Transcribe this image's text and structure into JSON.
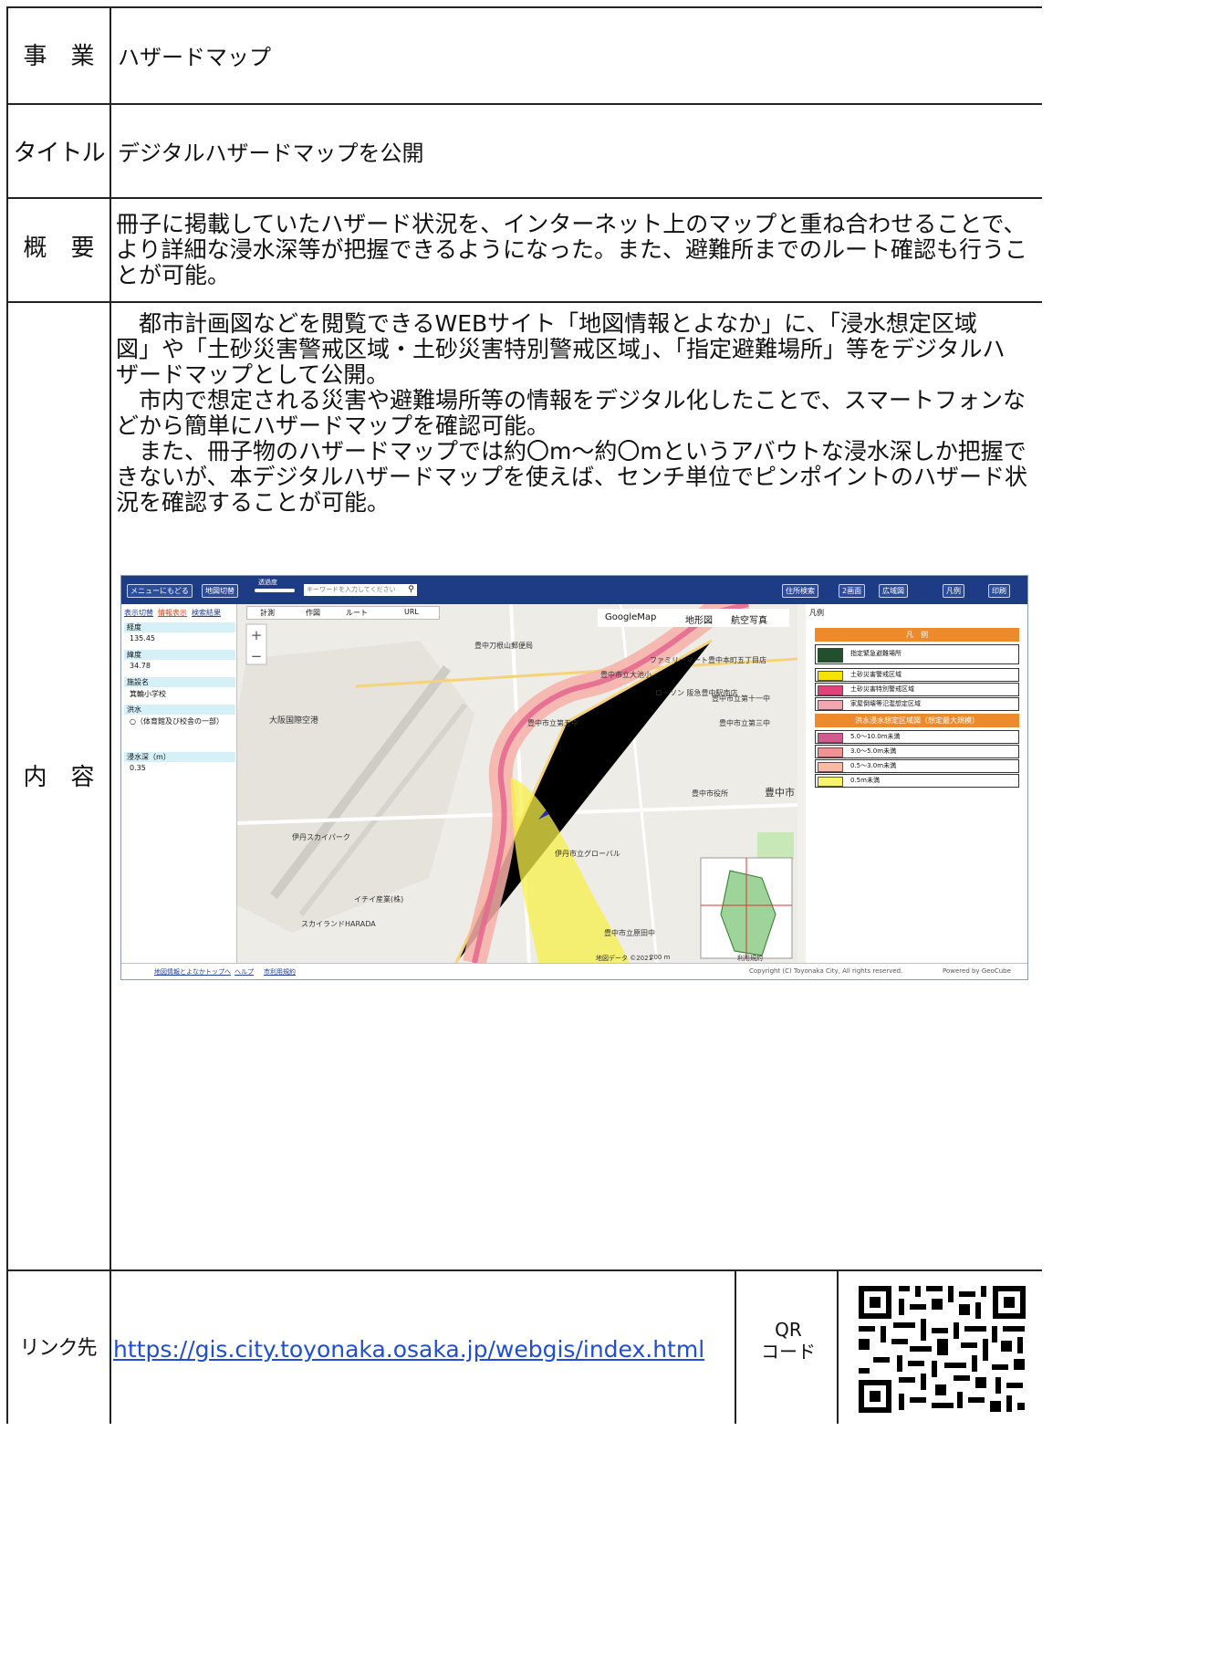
{
  "rows": {
    "business": {
      "label": "事　業",
      "value": "ハザードマップ"
    },
    "title": {
      "label": "タイトル",
      "value": "デジタルハザードマップを公開"
    },
    "overview": {
      "label": "概　要",
      "lines": [
        "冊子に掲載していたハザード状況を、インターネット上のマップと重ね合わせることで、",
        "より詳細な浸水深等が把握できるようになった。また、避難所までのルート確認も行うこ",
        "とが可能。"
      ]
    },
    "content": {
      "label": "内　容",
      "lines": [
        "　都市計画図などを閲覧できるWEBサイト「地図情報とよなか」に、「浸水想定区域",
        "図」や「土砂災害警戒区域・土砂災害特別警戒区域」、「指定避難場所」等をデジタルハ",
        "ザードマップとして公開。",
        "　市内で想定される災害や避難場所等の情報をデジタル化したことで、スマートフォンな",
        "どから簡単にハザードマップを確認可能。",
        "　また、冊子物のハザードマップでは約〇m～約〇mというアバウトな浸水深しか把握で",
        "きないが、本デジタルハザードマップを使えば、センチ単位でピンポイントのハザード状",
        "況を確認することが可能。"
      ]
    },
    "link": {
      "label": "リンク先",
      "url": "https://gis.city.toyonaka.osaka.jp/webgis/index.html",
      "qr_label_1": "QR",
      "qr_label_2": "コード"
    }
  },
  "screenshot": {
    "topbar": {
      "menu_button": "メニューにもどる",
      "map_switch": "地図切替",
      "opacity": "透過度",
      "search_placeholder": "キーワードを入力してください",
      "address_search": "住所検索",
      "two_screen": "2画面",
      "wide_area": "広域図",
      "legend": "凡例",
      "print": "印刷"
    },
    "left_pane": {
      "tabs": [
        "表示切替",
        "情報表示",
        "検索結果"
      ],
      "fields": [
        {
          "label": "経度",
          "value": "135.45"
        },
        {
          "label": "緯度",
          "value": "34.78"
        },
        {
          "label": "施設名",
          "value": "箕輪小学校"
        },
        {
          "label": "洪水",
          "value": "○（体育館及び校舎の一部）"
        },
        {
          "label": "浸水深（m）",
          "value": "0.35"
        }
      ]
    },
    "map": {
      "tools": [
        "計測",
        "作図",
        "ルート",
        "URL"
      ],
      "map_types": [
        "GoogleMap",
        "地形図",
        "航空写真"
      ],
      "labels": [
        "大阪国際空港",
        "豊中刀根山郵便局",
        "豊中市立第五中",
        "豊中市立第三中",
        "豊中市立大池小",
        "豊中市役所",
        "豊中市",
        "伊丹スカイパーク",
        "豊中市立原田中",
        "スカイランドHARADA",
        "伊丹市立グローバル",
        "ファミリーマート豊中本町五丁目店",
        "ローソン 阪急豊中駅南店",
        "イチイ産業(株)",
        "豊中市立第十一中"
      ],
      "footer_data": "地図データ ©2021",
      "scale": "200 m",
      "terms": "利用規約"
    },
    "legend_panel": {
      "title": "凡例",
      "header": "凡　例",
      "items": [
        {
          "label": "指定緊急避難場所",
          "color": "#ffffff"
        },
        {
          "label": "土砂災害警戒区域",
          "color": "#f5e400"
        },
        {
          "label": "土砂災害特別警戒区域",
          "color": "#e0427a"
        },
        {
          "label": "家屋倒壊等氾濫想定区域",
          "color": "#f2a6b0"
        }
      ],
      "flood_header": "洪水浸水想定区域図（想定最大規模）",
      "flood_items": [
        {
          "label": "5.0〜10.0m未満",
          "color": "#d15a8f"
        },
        {
          "label": "3.0〜5.0m未満",
          "color": "#f29393"
        },
        {
          "label": "0.5〜3.0m未満",
          "color": "#f7bca6"
        },
        {
          "label": "0.5m未満",
          "color": "#f7f36a"
        }
      ]
    },
    "bottom_bar": {
      "top_link": "地図情報とよなかトップへ",
      "help": "ヘルプ",
      "terms": "市利用規約",
      "copyright": "Copyright (C) Toyonaka City, All rights reserved.",
      "powered": "Powered by GeoCube"
    }
  }
}
